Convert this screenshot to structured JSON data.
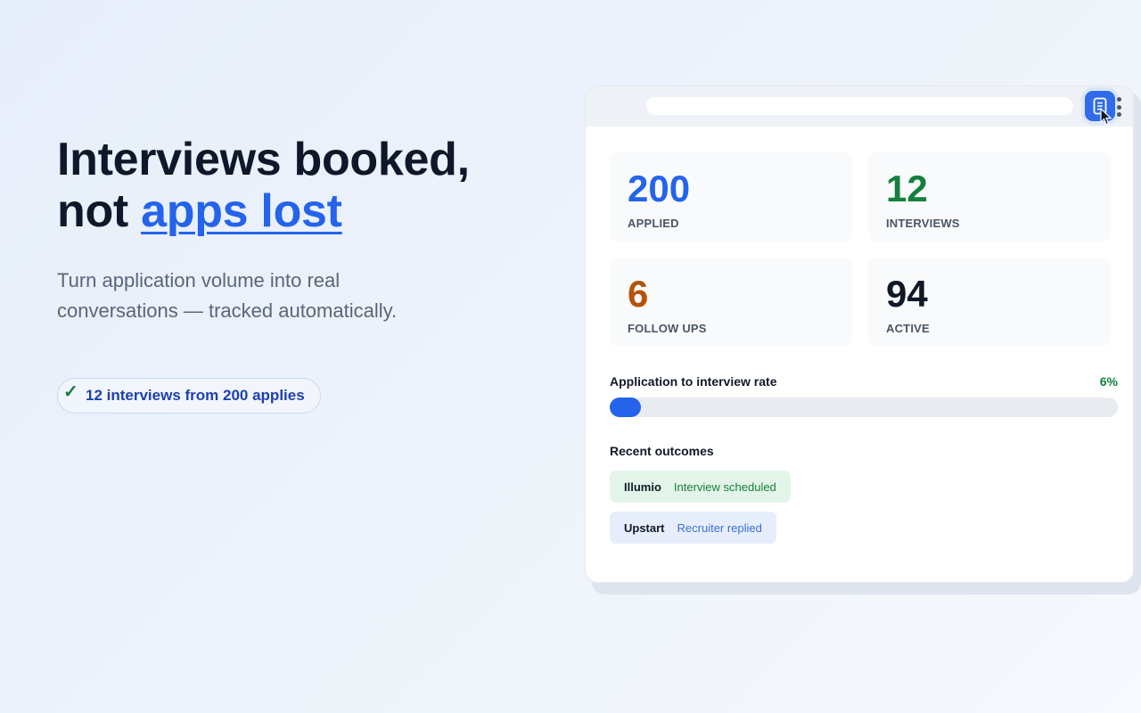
{
  "hero": {
    "headline_line1": "Interviews booked,",
    "headline_line2_prefix": "not",
    "headline_line2_accent": "apps lost",
    "subhead": "Turn application volume into real conversations — tracked automatically.",
    "badge_icon": "checkmark-icon",
    "badge_text": "12 interviews from 200 applies"
  },
  "colors": {
    "accent": "#2563eb",
    "green": "#15803d",
    "orange": "#b45309",
    "dark": "#111827"
  },
  "browser": {
    "extension_icon": "document-icon",
    "menu_icon": "kebab-menu-icon"
  },
  "stats": [
    {
      "value": "200",
      "label": "APPLIED",
      "color": "#2563eb"
    },
    {
      "value": "12",
      "label": "INTERVIEWS",
      "color": "#15803d"
    },
    {
      "value": "6",
      "label": "FOLLOW UPS",
      "color": "#b45309"
    },
    {
      "value": "94",
      "label": "ACTIVE",
      "color": "#111827"
    }
  ],
  "rate": {
    "label": "Application to interview rate",
    "value_text": "6%",
    "percent": 6
  },
  "recent": {
    "title": "Recent outcomes",
    "items": [
      {
        "company": "Illumio",
        "status": "Interview scheduled"
      },
      {
        "company": "Upstart",
        "status": "Recruiter replied"
      }
    ]
  }
}
